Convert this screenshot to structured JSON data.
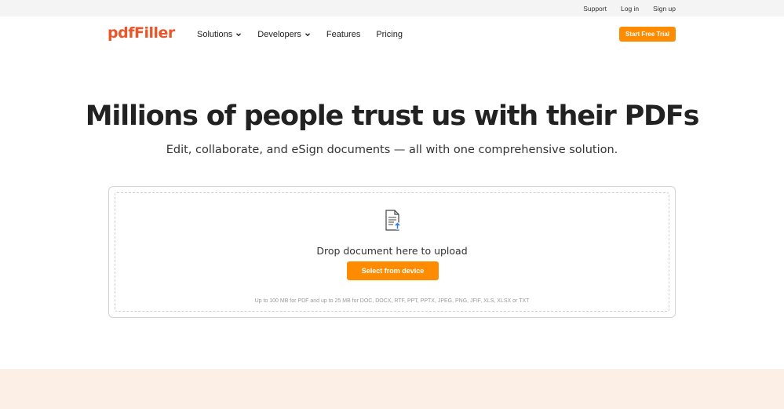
{
  "topbar": {
    "links": [
      "Support",
      "Log in",
      "Sign up"
    ]
  },
  "brand": {
    "logo_text": "pdfFiller",
    "accent_color": "#e8562a",
    "cta_color": "#ff8b00"
  },
  "nav": {
    "items": [
      {
        "label": "Solutions",
        "dropdown": true
      },
      {
        "label": "Developers",
        "dropdown": true
      },
      {
        "label": "Features",
        "dropdown": false
      },
      {
        "label": "Pricing",
        "dropdown": false
      }
    ],
    "cta_label": "Start Free Trial"
  },
  "hero": {
    "title": "Millions of people trust us with their PDFs",
    "subtitle": "Edit, collaborate, and eSign documents — all with one comprehensive solution."
  },
  "upload": {
    "icon": "document-upload-icon",
    "drop_text": "Drop document here to upload",
    "button_label": "Select from device",
    "limits_text": "Up to 100 MB for PDF and up to 25 MB for DOC, DOCX, RTF, PPT, PPTX, JPEG, PNG, JFIF, XLS, XLSX or TXT"
  }
}
